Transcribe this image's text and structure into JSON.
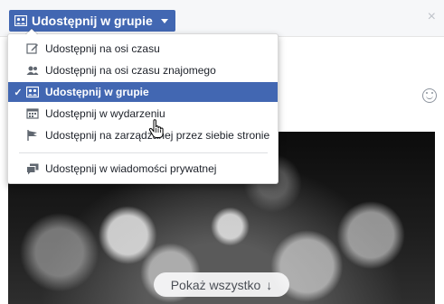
{
  "share_button": {
    "label": "Udostępnij w grupie",
    "icon": "group-icon"
  },
  "close_label": "×",
  "menu": {
    "items": [
      {
        "label": "Udostępnij na osi czasu",
        "icon": "edit-icon",
        "selected": false
      },
      {
        "label": "Udostępnij na osi czasu znajomego",
        "icon": "friend-icon",
        "selected": false
      },
      {
        "label": "Udostępnij w grupie",
        "icon": "group-icon",
        "selected": true,
        "check": "✓"
      },
      {
        "label": "Udostępnij w wydarzeniu",
        "icon": "calendar-icon",
        "selected": false
      },
      {
        "label": "Udostępnij na zarządzanej przez siebie stronie",
        "icon": "flag-icon",
        "selected": false
      },
      {
        "label": "Udostępnij w wiadomości prywatnej",
        "icon": "messages-icon",
        "selected": false
      }
    ]
  },
  "photo_overlay": {
    "show_all_label": "Pokaż wszystko",
    "arrow": "↓"
  },
  "colors": {
    "accent": "#4267b2",
    "icon_gray": "#606770"
  }
}
